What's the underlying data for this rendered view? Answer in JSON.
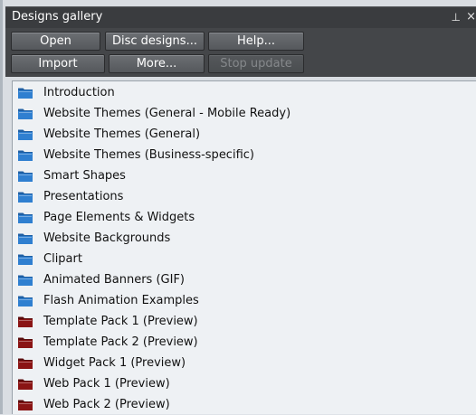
{
  "window": {
    "title": "Designs gallery",
    "pin_glyph": "⊥",
    "close_glyph": "×"
  },
  "toolbar": {
    "row1": [
      "Open",
      "Disc designs...",
      "Help..."
    ],
    "row2": [
      "Import",
      "More...",
      "Stop update"
    ]
  },
  "colors": {
    "folder_blue": "#2f7fd0",
    "folder_red": "#8a1414"
  },
  "items": [
    {
      "label": "Introduction",
      "icon": "folder-blue-icon"
    },
    {
      "label": "Website Themes (General - Mobile Ready)",
      "icon": "folder-blue-icon"
    },
    {
      "label": "Website Themes (General)",
      "icon": "folder-blue-icon"
    },
    {
      "label": "Website Themes (Business-specific)",
      "icon": "folder-blue-icon"
    },
    {
      "label": "Smart Shapes",
      "icon": "folder-blue-icon"
    },
    {
      "label": "Presentations",
      "icon": "folder-blue-icon"
    },
    {
      "label": "Page Elements & Widgets",
      "icon": "folder-blue-icon"
    },
    {
      "label": "Website Backgrounds",
      "icon": "folder-blue-icon"
    },
    {
      "label": "Clipart",
      "icon": "folder-blue-icon"
    },
    {
      "label": "Animated Banners (GIF)",
      "icon": "folder-blue-icon"
    },
    {
      "label": "Flash Animation Examples",
      "icon": "folder-blue-icon"
    },
    {
      "label": "Template Pack 1 (Preview)",
      "icon": "folder-red-icon"
    },
    {
      "label": "Template Pack 2 (Preview)",
      "icon": "folder-red-icon"
    },
    {
      "label": "Widget Pack 1 (Preview)",
      "icon": "folder-red-icon"
    },
    {
      "label": "Web Pack 1 (Preview)",
      "icon": "folder-red-icon"
    },
    {
      "label": "Web Pack 2 (Preview)",
      "icon": "folder-red-icon"
    }
  ]
}
